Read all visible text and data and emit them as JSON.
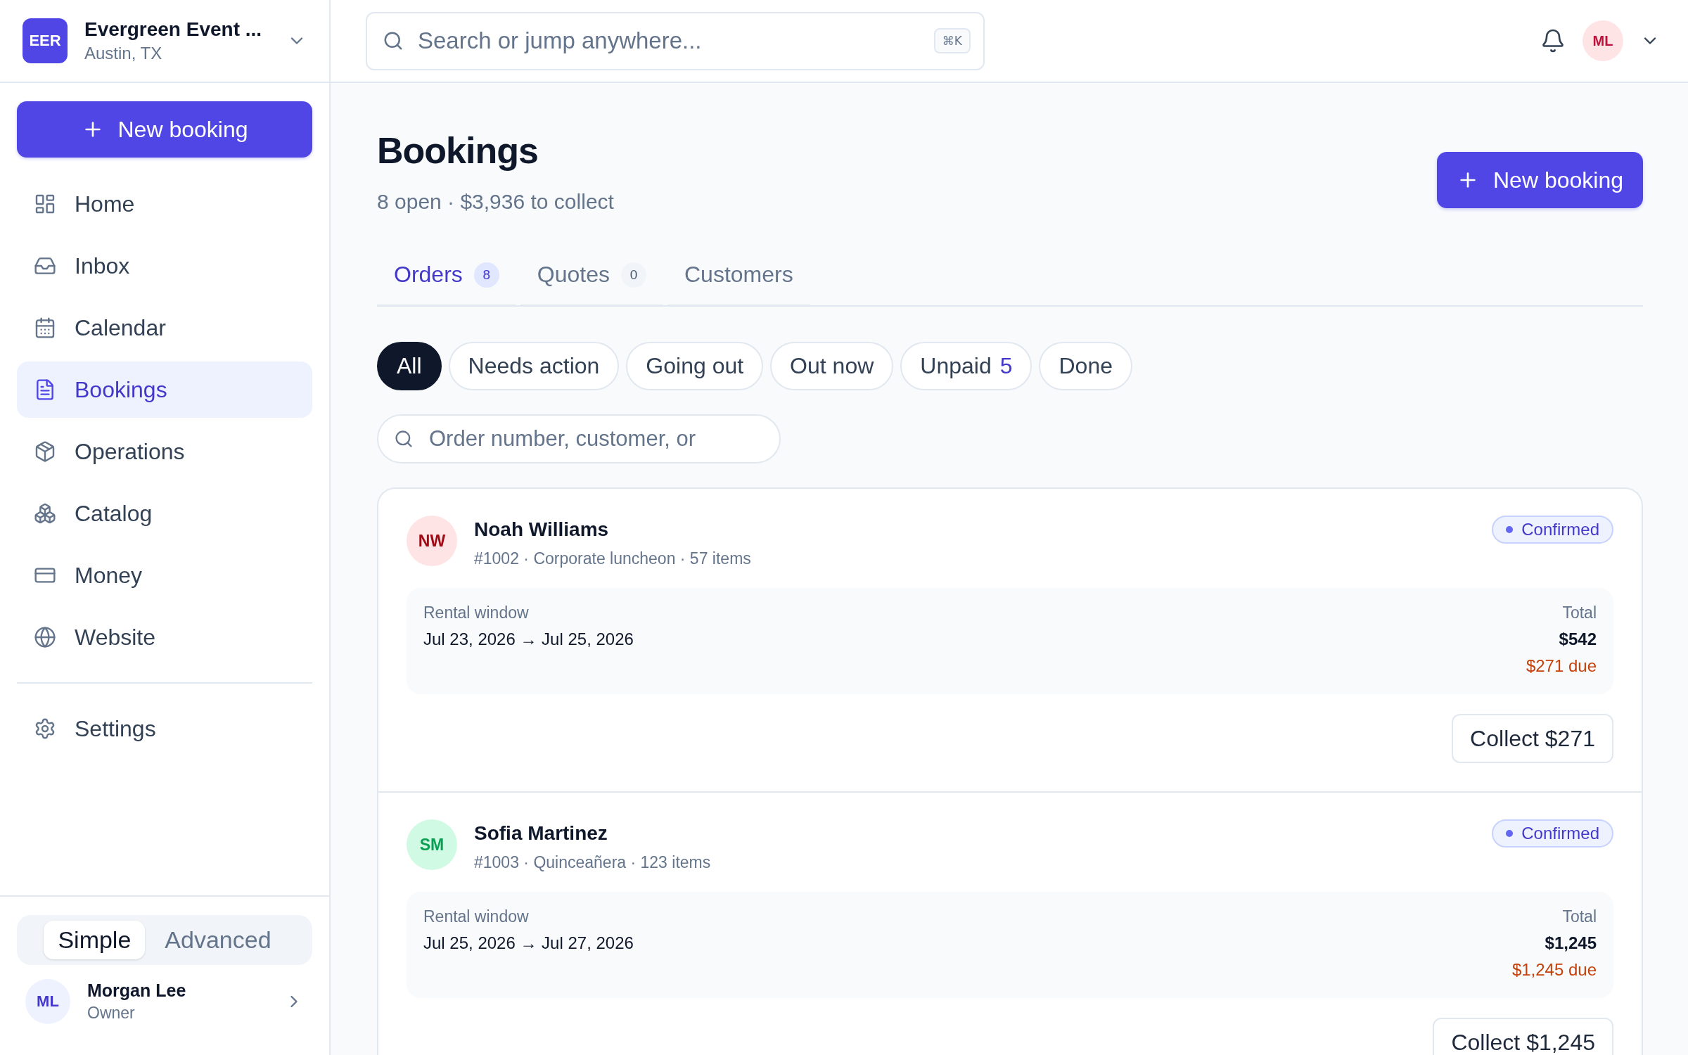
{
  "org": {
    "initials": "EER",
    "name": "Evergreen Event ...",
    "location": "Austin, TX"
  },
  "sidebar": {
    "new_button": "New booking",
    "items": [
      {
        "label": "Home",
        "selected": false
      },
      {
        "label": "Inbox",
        "selected": false
      },
      {
        "label": "Calendar",
        "selected": false
      },
      {
        "label": "Bookings",
        "selected": true
      },
      {
        "label": "Operations",
        "selected": false
      },
      {
        "label": "Catalog",
        "selected": false
      },
      {
        "label": "Money",
        "selected": false
      },
      {
        "label": "Website",
        "selected": false
      }
    ],
    "settings": {
      "label": "Settings",
      "selected": false
    },
    "modes": [
      {
        "label": "Simple",
        "selected": true
      },
      {
        "label": "Advanced",
        "selected": false
      }
    ],
    "user": {
      "initials": "ML",
      "name": "Morgan Lee",
      "role": "Owner"
    }
  },
  "topbar": {
    "search_placeholder": "Search or jump anywhere...",
    "shortcut": "⌘K",
    "avatar": "ML"
  },
  "page": {
    "title": "Bookings",
    "subtitle": "8 open · $3,936 to collect",
    "new_button": "New booking"
  },
  "tabs": [
    {
      "label": "Orders",
      "count": "8",
      "selected": true
    },
    {
      "label": "Quotes",
      "count": "0",
      "selected": false
    },
    {
      "label": "Customers",
      "selected": false
    }
  ],
  "filters": [
    {
      "label": "All",
      "selected": true
    },
    {
      "label": "Needs action",
      "selected": false
    },
    {
      "label": "Going out",
      "selected": false
    },
    {
      "label": "Out now",
      "selected": false
    },
    {
      "label": "Unpaid",
      "count": "5",
      "selected": false
    },
    {
      "label": "Done",
      "selected": false
    }
  ],
  "order_search": {
    "placeholder": "Order number, customer, or"
  },
  "orders": [
    {
      "initials": "NW",
      "color": "#ffe4e6",
      "name": "Noah Williams",
      "meta": "#1002 · Corporate luncheon · 57 items",
      "status": "Confirmed",
      "window_label": "Rental window",
      "window": "Jul 23, 2026 → Jul 25, 2026",
      "total_label": "Total",
      "total": "$542",
      "due": "$271 due",
      "action": "Collect $271"
    },
    {
      "initials": "SM",
      "color": "#d1fae5",
      "name": "Sofia Martinez",
      "meta": "#1003 · Quinceañera · 123 items",
      "status": "Confirmed",
      "window_label": "Rental window",
      "window": "Jul 25, 2026 → Jul 27, 2026",
      "total_label": "Total",
      "total": "$1,245",
      "due": "$1,245 due",
      "action": "Collect $1,245"
    }
  ]
}
